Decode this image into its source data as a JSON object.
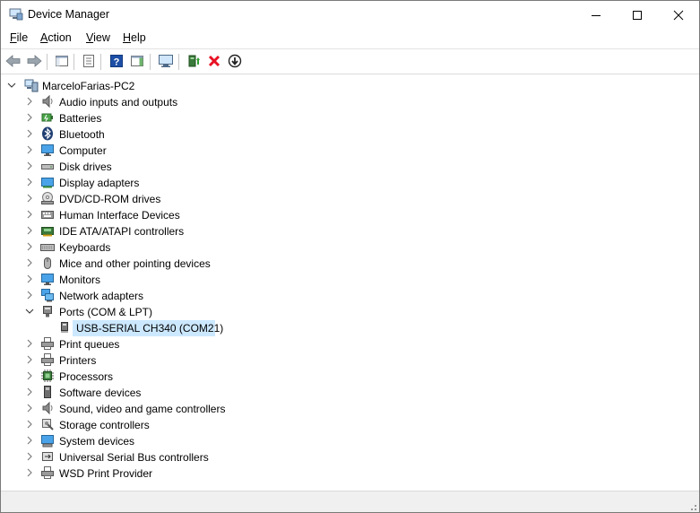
{
  "window": {
    "title": "Device Manager"
  },
  "menubar": {
    "items": [
      {
        "first": "F",
        "rest": "ile"
      },
      {
        "first": "A",
        "rest": "ction"
      },
      {
        "first": "V",
        "rest": "iew"
      },
      {
        "first": "H",
        "rest": "elp"
      }
    ]
  },
  "toolbar": {
    "buttons": [
      {
        "icon": "back-arrow-icon"
      },
      {
        "icon": "forward-arrow-icon"
      },
      {
        "icon": "show-hide-console-tree-icon"
      },
      {
        "icon": "properties-icon"
      },
      {
        "icon": "help-icon"
      },
      {
        "icon": "action-pane-icon"
      },
      {
        "icon": "scan-hardware-icon"
      },
      {
        "icon": "update-driver-icon"
      },
      {
        "icon": "uninstall-device-icon"
      },
      {
        "icon": "disable-device-icon"
      }
    ]
  },
  "tree": {
    "root": "MarceloFarias-PC2",
    "categories": [
      {
        "label": "Audio inputs and outputs",
        "icon": "speaker-icon"
      },
      {
        "label": "Batteries",
        "icon": "battery-icon"
      },
      {
        "label": "Bluetooth",
        "icon": "bluetooth-icon"
      },
      {
        "label": "Computer",
        "icon": "computer-icon"
      },
      {
        "label": "Disk drives",
        "icon": "disk-drive-icon"
      },
      {
        "label": "Display adapters",
        "icon": "display-adapter-icon"
      },
      {
        "label": "DVD/CD-ROM drives",
        "icon": "dvd-drive-icon"
      },
      {
        "label": "Human Interface Devices",
        "icon": "hid-icon"
      },
      {
        "label": "IDE ATA/ATAPI controllers",
        "icon": "ide-controller-icon"
      },
      {
        "label": "Keyboards",
        "icon": "keyboard-icon"
      },
      {
        "label": "Mice and other pointing devices",
        "icon": "mouse-icon"
      },
      {
        "label": "Monitors",
        "icon": "monitor-icon"
      },
      {
        "label": "Network adapters",
        "icon": "network-adapter-icon"
      },
      {
        "label": "Ports (COM & LPT)",
        "icon": "port-icon",
        "expanded": true
      },
      {
        "label": "Print queues",
        "icon": "printer-icon"
      },
      {
        "label": "Printers",
        "icon": "printer-icon"
      },
      {
        "label": "Processors",
        "icon": "processor-icon"
      },
      {
        "label": "Software devices",
        "icon": "software-device-icon"
      },
      {
        "label": "Sound, video and game controllers",
        "icon": "speaker-icon"
      },
      {
        "label": "Storage controllers",
        "icon": "storage-controller-icon"
      },
      {
        "label": "System devices",
        "icon": "system-device-icon"
      },
      {
        "label": "Universal Serial Bus controllers",
        "icon": "usb-icon"
      },
      {
        "label": "WSD Print Provider",
        "icon": "printer-icon"
      }
    ],
    "ports_child": "USB-SERIAL CH340 (COM21)"
  },
  "colors": {
    "selection": "#cce8ff",
    "uninstall_red": "#e81123",
    "help_blue": "#1c4fa5"
  }
}
